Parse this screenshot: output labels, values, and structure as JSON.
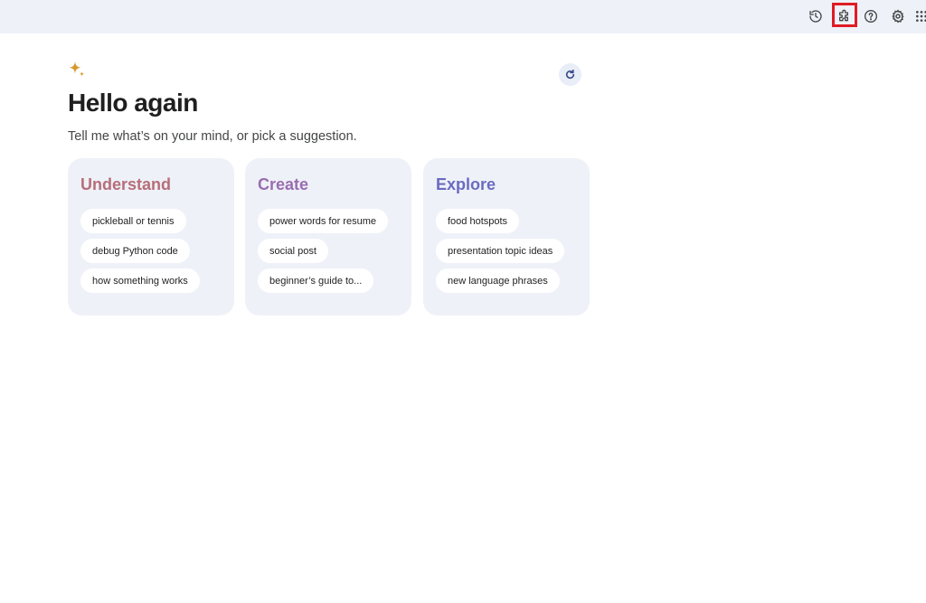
{
  "topbar": {
    "icons": [
      {
        "name": "history-icon",
        "label": "Recent"
      },
      {
        "name": "extensions-icon",
        "label": "Extensions",
        "highlighted": true
      },
      {
        "name": "help-icon",
        "label": "Help"
      },
      {
        "name": "settings-icon",
        "label": "Settings"
      },
      {
        "name": "apps-grid-icon",
        "label": "Apps"
      }
    ],
    "highlight_color": "#e01b24"
  },
  "main": {
    "sparkle_icon": "gemini-sparkle-icon",
    "refresh_icon": "refresh-icon",
    "greeting": "Hello again",
    "subtitle": "Tell me what’s on your mind, or pick a suggestion.",
    "cards": [
      {
        "title": "Understand",
        "color": "#b76e79",
        "suggestions": [
          "pickleball or tennis",
          "debug Python code",
          "how something works"
        ]
      },
      {
        "title": "Create",
        "color": "#9a6db0",
        "suggestions": [
          "power words for resume",
          "social post",
          "beginner’s guide to..."
        ]
      },
      {
        "title": "Explore",
        "color": "#6b6bc0",
        "suggestions": [
          "food hotspots",
          "presentation topic ideas",
          "new language phrases"
        ]
      }
    ]
  },
  "colors": {
    "topbar_bg": "#eef1f8",
    "card_bg": "#eef1f8",
    "sparkle": "#d69a2d"
  }
}
